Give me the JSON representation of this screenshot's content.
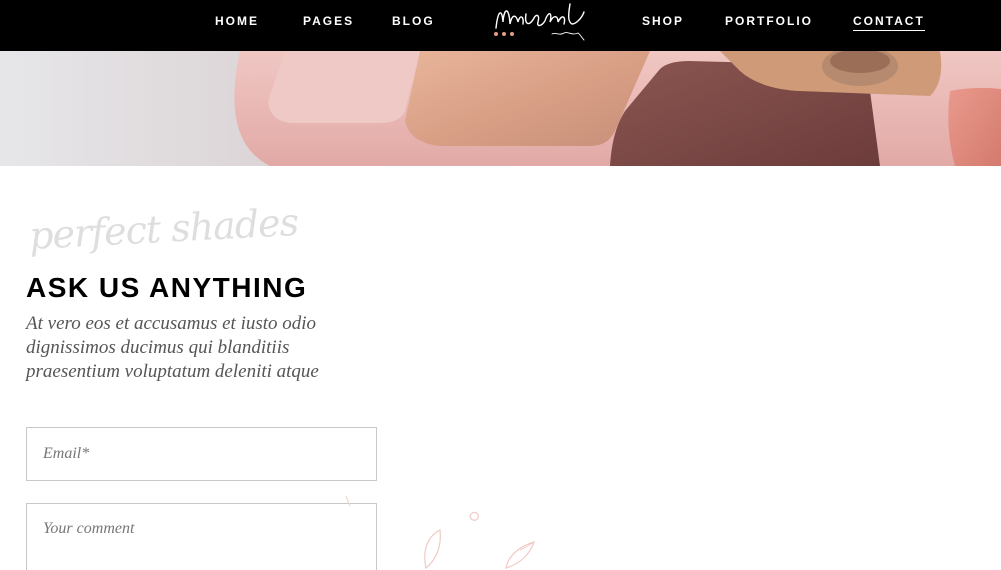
{
  "nav": {
    "links": [
      {
        "label": "HOME"
      },
      {
        "label": "PAGES"
      },
      {
        "label": "BLOG"
      },
      {
        "label": "SHOP"
      },
      {
        "label": "PORTFOLIO"
      },
      {
        "label": "CONTACT",
        "active": true
      }
    ],
    "logo_text": "Mischa",
    "logo_sub": "beauty"
  },
  "section": {
    "script": "perfect shades",
    "heading": "ASK US ANYTHING",
    "intro": "At vero eos et accusamus et iusto odio dignissimos ducimus qui blanditiis praesentium voluptatum deleniti atque"
  },
  "form": {
    "email_placeholder": "Email*",
    "comment_placeholder": "Your comment"
  },
  "colors": {
    "nav_bg": "#000000",
    "accent": "#e89a8c",
    "text": "#000000",
    "muted": "#555555"
  }
}
